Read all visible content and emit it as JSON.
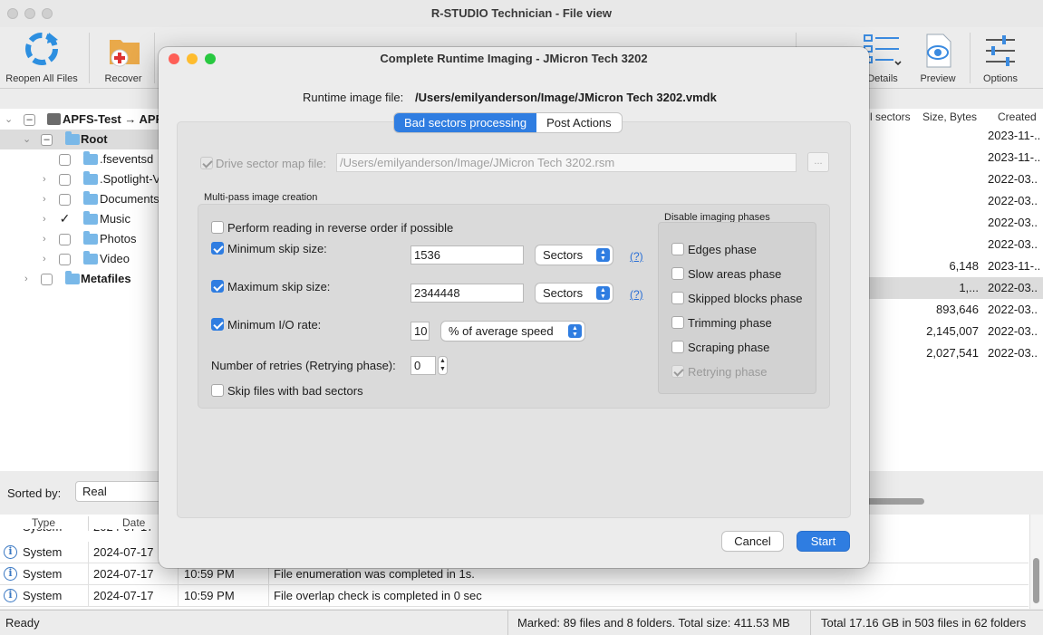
{
  "app": {
    "window_title": "R-STUDIO Technician - File view"
  },
  "toolbar": {
    "items": [
      {
        "label": "Reopen All Files",
        "icon": "reopen-icon"
      },
      {
        "label": "Recover",
        "icon": "recover-icon"
      },
      {
        "label": "Details",
        "icon": "details-icon"
      },
      {
        "label": "Preview",
        "icon": "preview-icon"
      },
      {
        "label": "Options",
        "icon": "options-icon"
      }
    ]
  },
  "tree": {
    "items": [
      {
        "label": "APFS-Test → APF",
        "bold": true
      },
      {
        "label": "Root",
        "bold": true
      },
      {
        "label": ".fseventsd"
      },
      {
        "label": ".Spotlight-V"
      },
      {
        "label": "Documents"
      },
      {
        "label": "Music",
        "checked": true
      },
      {
        "label": "Photos"
      },
      {
        "label": "Video"
      },
      {
        "label": "Metafiles",
        "bold": true
      }
    ]
  },
  "file_list": {
    "headers": [
      "l sectors",
      "Size, Bytes",
      "Created"
    ],
    "rows": [
      {
        "size": "",
        "created": "2023-11-.."
      },
      {
        "size": "",
        "created": "2023-11-.."
      },
      {
        "size": "",
        "created": "2022-03.."
      },
      {
        "size": "",
        "created": "2022-03.."
      },
      {
        "size": "",
        "created": "2022-03.."
      },
      {
        "size": "",
        "created": "2022-03.."
      },
      {
        "size": "6,148",
        "created": "2023-11-.."
      },
      {
        "size": "1,...",
        "created": "2022-03.."
      },
      {
        "size": "893,646",
        "created": "2022-03.."
      },
      {
        "size": "2,145,007",
        "created": "2022-03.."
      },
      {
        "size": "2,027,541",
        "created": "2022-03.."
      }
    ]
  },
  "sort": {
    "label": "Sorted by:",
    "value": "Real"
  },
  "log": {
    "headers": [
      "Type",
      "Date"
    ],
    "partial_row": {
      "type": "System",
      "date": "2024-07-17"
    },
    "rows": [
      {
        "type": "System",
        "date": "2024-07-17",
        "time": "",
        "message": ""
      },
      {
        "type": "System",
        "date": "2024-07-17",
        "time": "10:59 PM",
        "message": "File enumeration was completed in 1s."
      },
      {
        "type": "System",
        "date": "2024-07-17",
        "time": "10:59 PM",
        "message": "File overlap check is completed in 0 sec"
      }
    ]
  },
  "status_bar": {
    "left": "Ready",
    "marked": "Marked: 89 files and 8 folders. Total size: 411.53 MB",
    "total": "Total 17.16 GB in 503 files in 62 folders"
  },
  "dialog": {
    "title": "Complete Runtime Imaging - JMicron Tech 3202",
    "image_file_label": "Runtime image file:",
    "image_file_value": "/Users/emilyanderson/Image/JMicron Tech 3202.vmdk",
    "tabs": [
      {
        "label": "Bad sectors processing",
        "active": true
      },
      {
        "label": "Post Actions",
        "active": false
      }
    ],
    "sector_map": {
      "label": "Drive sector map file:",
      "value": "/Users/emilyanderson/Image/JMicron Tech 3202.rsm",
      "browse": "..."
    },
    "multipass": {
      "section_title": "Multi-pass image creation",
      "reverse_label": "Perform reading in reverse order if possible",
      "min_skip_label": "Minimum skip size:",
      "min_skip_value": "1536",
      "min_skip_unit": "Sectors",
      "max_skip_label": "Maximum skip size:",
      "max_skip_value": "2344448",
      "max_skip_unit": "Sectors",
      "min_io_label": "Minimum I/O rate:",
      "min_io_value": "10",
      "min_io_unit": "% of average speed",
      "help": "(?)",
      "retries_label": "Number of retries (Retrying phase):",
      "retries_value": "0",
      "skip_bad_label": "Skip files with bad sectors"
    },
    "phases": {
      "title": "Disable imaging phases",
      "items": [
        {
          "label": "Edges phase",
          "checked": false
        },
        {
          "label": "Slow areas phase",
          "checked": false
        },
        {
          "label": "Skipped blocks phase",
          "checked": false
        },
        {
          "label": "Trimming phase",
          "checked": false
        },
        {
          "label": "Scraping phase",
          "checked": false
        },
        {
          "label": "Retrying phase",
          "checked": true,
          "disabled": true
        }
      ]
    },
    "cancel": "Cancel",
    "start": "Start"
  },
  "colors": {
    "accent": "#2f7de1",
    "close": "#fe5f57",
    "minimize": "#febc2e",
    "zoom": "#28c840"
  }
}
